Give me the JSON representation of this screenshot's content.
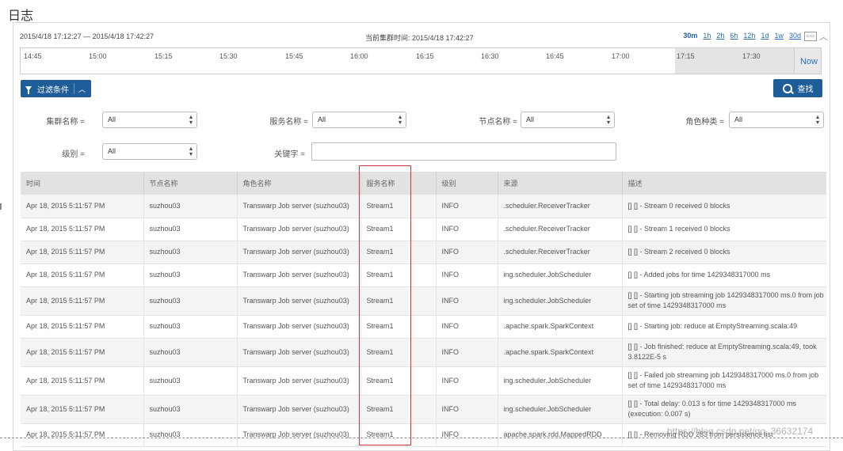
{
  "page": {
    "title": "日志"
  },
  "range": {
    "text": "2015/4/18 17:12:27 — 2015/4/18 17:42:27",
    "current": "当前集群时间: 2015/4/18 17:42:27",
    "zooms": [
      "30m",
      "1h",
      "2h",
      "6h",
      "12h",
      "1d",
      "1w",
      "30d"
    ],
    "active_zoom": "30m"
  },
  "timeline": {
    "ticks": [
      "14:45",
      "15:00",
      "15:15",
      "15:30",
      "15:45",
      "16:00",
      "16:15",
      "16:30",
      "16:45",
      "17:00",
      "17:15",
      "17:30"
    ],
    "now_label": "Now"
  },
  "filter": {
    "button_label": "过滤条件",
    "search_label": "查找",
    "cluster_label": "集群名称",
    "service_label": "服务名称",
    "node_label": "节点名称",
    "role_label": "角色种类",
    "level_label": "级别",
    "keyword_label": "关键字",
    "eq": "=",
    "cluster_value": "All",
    "service_value": "All",
    "node_value": "All",
    "role_value": "All",
    "level_value": "All",
    "keyword_value": ""
  },
  "table": {
    "headers": [
      "时间",
      "节点名称",
      "角色名称",
      "服务名称",
      "级别",
      "来源",
      "描述"
    ],
    "rows": [
      [
        "Apr 18, 2015 5:11:57 PM",
        "suzhou03",
        "Transwarp Job server (suzhou03)",
        "Stream1",
        "INFO",
        ".scheduler.ReceiverTracker",
        "[] [] - Stream 0 received 0 blocks"
      ],
      [
        "Apr 18, 2015 5:11:57 PM",
        "suzhou03",
        "Transwarp Job server (suzhou03)",
        "Stream1",
        "INFO",
        ".scheduler.ReceiverTracker",
        "[] [] - Stream 1 received 0 blocks"
      ],
      [
        "Apr 18, 2015 5:11:57 PM",
        "suzhou03",
        "Transwarp Job server (suzhou03)",
        "Stream1",
        "INFO",
        ".scheduler.ReceiverTracker",
        "[] [] - Stream 2 received 0 blocks"
      ],
      [
        "Apr 18, 2015 5:11:57 PM",
        "suzhou03",
        "Transwarp Job server (suzhou03)",
        "Stream1",
        "INFO",
        "ing.scheduler.JobScheduler",
        "[] [] - Added jobs for time 1429348317000 ms"
      ],
      [
        "Apr 18, 2015 5:11:57 PM",
        "suzhou03",
        "Transwarp Job server (suzhou03)",
        "Stream1",
        "INFO",
        "ing.scheduler.JobScheduler",
        "[] [] - Starting job streaming job 1429348317000 ms.0 from job set of time 1429348317000 ms"
      ],
      [
        "Apr 18, 2015 5:11:57 PM",
        "suzhou03",
        "Transwarp Job server (suzhou03)",
        "Stream1",
        "INFO",
        ".apache.spark.SparkContext",
        "[] [] - Starting job: reduce at EmptyStreaming.scala:49"
      ],
      [
        "Apr 18, 2015 5:11:57 PM",
        "suzhou03",
        "Transwarp Job server (suzhou03)",
        "Stream1",
        "INFO",
        ".apache.spark.SparkContext",
        "[] [] - Job finished: reduce at EmptyStreaming.scala:49, took 3.8122E-5 s"
      ],
      [
        "Apr 18, 2015 5:11:57 PM",
        "suzhou03",
        "Transwarp Job server (suzhou03)",
        "Stream1",
        "INFO",
        "ing.scheduler.JobScheduler",
        "[] [] - Failed job streaming job 1429348317000 ms.0 from job set of time 1429348317000 ms"
      ],
      [
        "Apr 18, 2015 5:11:57 PM",
        "suzhou03",
        "Transwarp Job server (suzhou03)",
        "Stream1",
        "INFO",
        "ing.scheduler.JobScheduler",
        "[] [] - Total delay: 0.013 s for time 1429348317000 ms (execution: 0.007 s)"
      ],
      [
        "Apr 18, 2015 5:11:57 PM",
        "suzhou03",
        "Transwarp Job server (suzhou03)",
        "Stream1",
        "INFO",
        "apache.spark.rdd.MappedRDD",
        "[] [] - Removing RDD 283 from persistence list"
      ]
    ]
  },
  "watermark": "https://blog.csdn.net/qq_36632174"
}
